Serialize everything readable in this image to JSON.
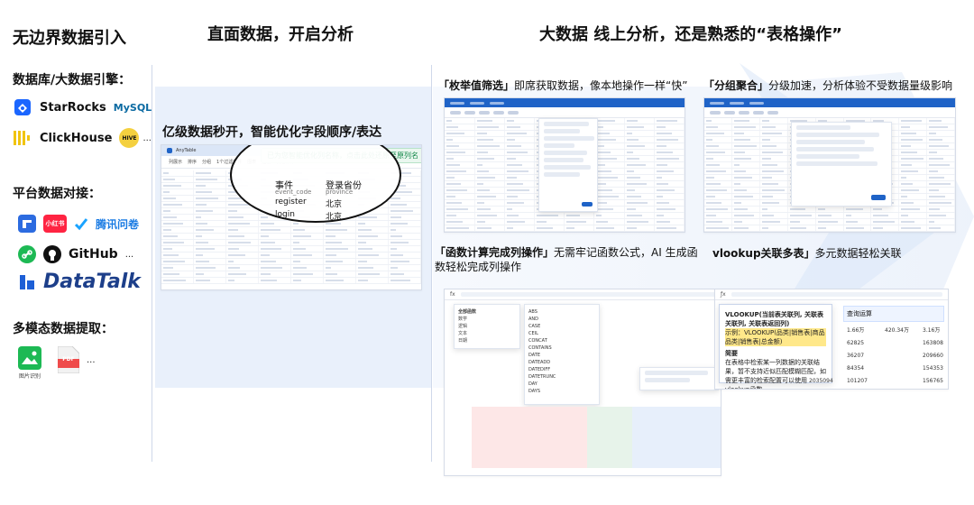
{
  "headers": {
    "h1": "无边界数据引入",
    "h2": "直面数据，开启分析",
    "h3": "大数据 线上分析，还是熟悉的“表格操作”"
  },
  "left": {
    "db_title": "数据库/大数据引擎：",
    "platform_title": "平台数据对接：",
    "multimodal_title": "多模态数据提取：",
    "logos": {
      "starrocks": "StarRocks",
      "mysql": "MySQL",
      "clickhouse": "ClickHouse",
      "hive": "HIVE",
      "xiaohongshu": "小红书",
      "tencent_wenjuan": "腾讯问卷",
      "github": "GitHub",
      "datatalk": "DataTalk",
      "pdf": "PDF",
      "image_recognition": "图片识别",
      "ellipsis": "..."
    }
  },
  "middle": {
    "title": "亿级数据秒开，智能优化字段顺序/表达",
    "toast": "已为您智能优化列名称，点击此处还原至原列名",
    "app_name": "AnyTable",
    "toolbar": {
      "columns": "列展示",
      "sort": "排序",
      "group": "分组",
      "filter": "1个过滤条件",
      "chart": "图表",
      "pivot": "透视",
      "quick_calc": "快速计算"
    },
    "magnified": {
      "col1_header": "事件",
      "col1_sub": "event_code",
      "col2_header": "登录省份",
      "col2_sub": "province",
      "row1_c1": "register",
      "row1_c2": "北京",
      "row2_c1": "login",
      "row2_c2": "北京"
    }
  },
  "right": {
    "card1": {
      "highlight": "「枚举值筛选」",
      "rest": "即席获取数据，像本地操作一样“快”"
    },
    "card2": {
      "highlight": "「分组聚合」",
      "rest": "分级加速，分析体验不受数据量级影响"
    },
    "card3": {
      "highlight": "「函数计算完成列操作」",
      "rest": "无需牢记函数公式，AI 生成函数轻松完成列操作",
      "formula_label": "fx"
    },
    "card4": {
      "highlight": "vlookup关联多表」",
      "rest": "多元数据轻松关联",
      "formula_bar": "VLOOKUP(当前表关联列, 关联表关联列, 关联表返回列)",
      "example": "示例：VLOOKUP(品类|销售表|商品品类|销售表|总金额)",
      "intro_title": "简要",
      "intro_text": "在表格中检索某一列数据的关联结果，暂不支持近似匹配模糊匹配，如需更丰富的检索配置可以使用vlookup函数",
      "tag1": "查询运算",
      "values": [
        "1.66万",
        "420.34万",
        "3.16万",
        "62825",
        "163808",
        "36207",
        "209660",
        "84354",
        "154353",
        "101207",
        "156765",
        "2035094"
      ]
    },
    "func_list": [
      "ABS",
      "AND",
      "CASE",
      "CEIL",
      "CONCAT",
      "CONTAINS",
      "DATE",
      "DATEADD",
      "DATEDIFF",
      "DATETRUNC",
      "DAY",
      "DAYS"
    ],
    "func_categories": [
      "全部函数",
      "数学",
      "逻辑",
      "文本",
      "日期"
    ]
  },
  "colors": {
    "brand_blue": "#1f63c7",
    "light_blue_bg": "#e8f0fb",
    "arrow_blue": "#dbe6f7",
    "green_toast": "#13884a"
  }
}
